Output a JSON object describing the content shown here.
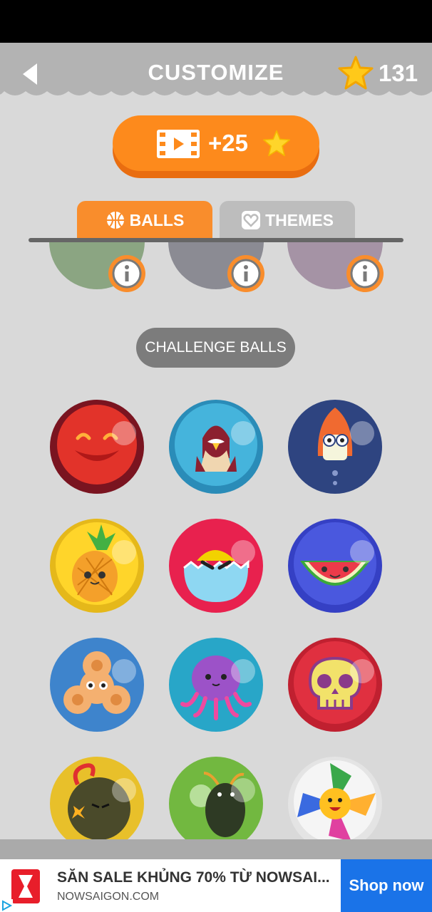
{
  "header": {
    "title": "CUSTOMIZE",
    "star_count": "131",
    "bg_color": "#b3b3b3"
  },
  "reward_button": {
    "label": "+25",
    "icon": "film-icon"
  },
  "tabs": [
    {
      "label": "BALLS",
      "icon": "basketball-icon",
      "active": true
    },
    {
      "label": "THEMES",
      "icon": "heart-icon",
      "active": false
    }
  ],
  "section_label": "CHALLENGE BALLS",
  "peek_balls": [
    {
      "icon": "info-icon",
      "color": "#4a7a3a"
    },
    {
      "icon": "info-icon",
      "color": "#4a4a5a"
    },
    {
      "icon": "info-icon",
      "color": "#7a5a7a"
    }
  ],
  "balls": [
    {
      "name": "smiling-red-face-icon",
      "color": "#7a1420"
    },
    {
      "name": "eagle-icon",
      "color": "#45b4dc"
    },
    {
      "name": "rocket-icon",
      "color": "#2e4480"
    },
    {
      "name": "pineapple-icon",
      "color": "#ffd52a"
    },
    {
      "name": "cracked-egg-icon",
      "color": "#e8214e"
    },
    {
      "name": "watermelon-icon",
      "color": "#3540c4"
    },
    {
      "name": "fidget-spinner-icon",
      "color": "#3e84cc"
    },
    {
      "name": "octopus-icon",
      "color": "#28a6c8"
    },
    {
      "name": "skull-icon",
      "color": "#e03040"
    },
    {
      "name": "bomb-icon",
      "color": "#e8c02a"
    },
    {
      "name": "bug-icon",
      "color": "#72b840"
    },
    {
      "name": "pinwheel-icon",
      "color": "#f2f2f2"
    }
  ],
  "ad": {
    "title": "SĂN SALE KHỦNG 70% TỪ NOWSAI...",
    "url": "NOWSAIGON.COM",
    "cta": "Shop now"
  }
}
